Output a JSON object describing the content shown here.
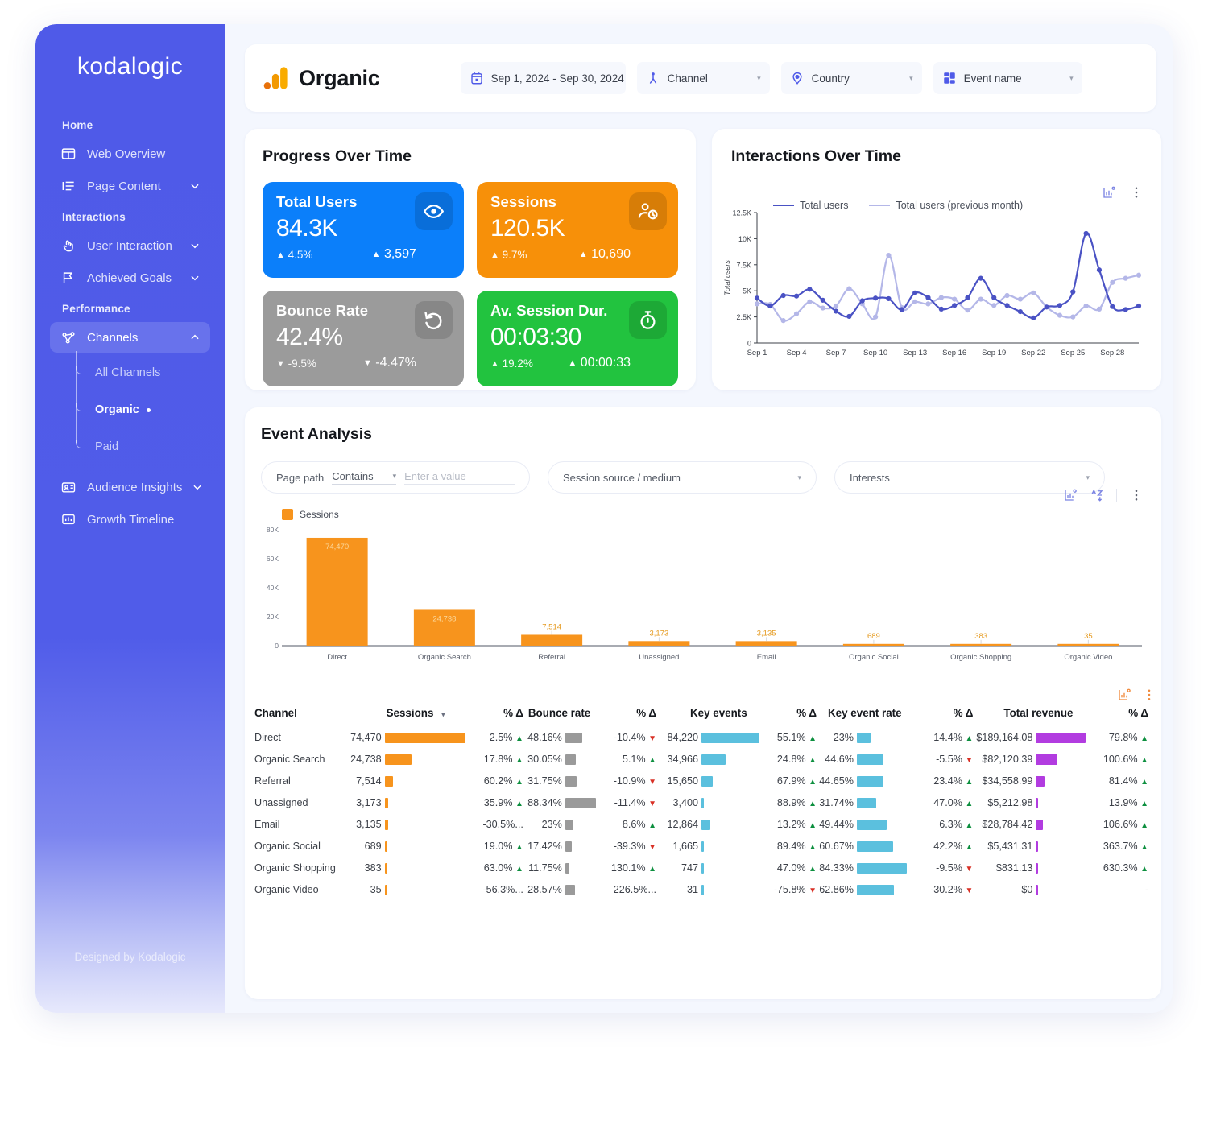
{
  "sidebar": {
    "brand": "kodalogic",
    "footer": "Designed by Kodalogic",
    "sections": [
      {
        "label": "Home",
        "items": [
          {
            "label": "Web Overview",
            "icon": "web-overview-icon",
            "chevron": false
          },
          {
            "label": "Page Content",
            "icon": "page-content-icon",
            "chevron": true
          }
        ]
      },
      {
        "label": "Interactions",
        "items": [
          {
            "label": "User Interaction",
            "icon": "hand-pointer-icon",
            "chevron": true
          },
          {
            "label": "Achieved Goals",
            "icon": "flag-icon",
            "chevron": true
          }
        ]
      },
      {
        "label": "Performance",
        "items": [
          {
            "label": "Channels",
            "icon": "share-nodes-icon",
            "chevron": true,
            "active": true
          }
        ]
      }
    ],
    "subitems": [
      {
        "label": "All Channels",
        "selected": false
      },
      {
        "label": "Organic",
        "selected": true
      },
      {
        "label": "Paid",
        "selected": false
      }
    ],
    "tail_items": [
      {
        "label": "Audience Insights",
        "icon": "audience-icon",
        "chevron": true
      },
      {
        "label": "Growth Timeline",
        "icon": "bar-chart-icon",
        "chevron": false
      }
    ]
  },
  "header": {
    "title": "Organic",
    "logo_icon": "google-analytics-icon",
    "filters": [
      {
        "label": "Sep 1, 2024 - Sep 30, 2024",
        "icon": "calendar-icon"
      },
      {
        "label": "Channel",
        "icon": "person-icon"
      },
      {
        "label": "Country",
        "icon": "location-pin-icon"
      },
      {
        "label": "Event name",
        "icon": "grid-blocks-icon"
      }
    ]
  },
  "progress": {
    "title": "Progress Over Time",
    "cards": [
      {
        "title": "Total Users",
        "value": "84.3K",
        "delta_pct": "4.5%",
        "delta_dir": "up",
        "delta_abs": "3,597",
        "abs_dir": "up",
        "color": "#0b7ffa",
        "icon": "eye-icon"
      },
      {
        "title": "Sessions",
        "value": "120.5K",
        "delta_pct": "9.7%",
        "delta_dir": "up",
        "delta_abs": "10,690",
        "abs_dir": "up",
        "color": "#f79009",
        "icon": "user-clock-icon"
      },
      {
        "title": "Bounce Rate",
        "value": "42.4%",
        "delta_pct": "-9.5%",
        "delta_dir": "down",
        "delta_abs": "-4.47%",
        "abs_dir": "down",
        "color": "#9b9b9b",
        "icon": "undo-icon"
      },
      {
        "title": "Av. Session Dur.",
        "value": "00:03:30",
        "delta_pct": "19.2%",
        "delta_dir": "up",
        "delta_abs": "00:00:33",
        "abs_dir": "up",
        "color": "#22c33f",
        "icon": "stopwatch-icon"
      }
    ]
  },
  "interactions": {
    "title": "Interactions Over Time",
    "tools": [
      {
        "icon": "insights-chart-icon"
      },
      {
        "icon": "more-vertical-icon"
      }
    ]
  },
  "event_analysis": {
    "title": "Event Analysis",
    "page_path_label": "Page path",
    "page_path_operator": "Contains",
    "page_path_placeholder": "Enter a value",
    "source_medium": "Session source / medium",
    "interests": "Interests",
    "tools": [
      {
        "icon": "insights-chart-icon"
      },
      {
        "icon": "sort-alpha-icon"
      },
      {
        "icon": "more-vertical-icon"
      }
    ],
    "table_tools": [
      {
        "icon": "insights-chart-icon"
      },
      {
        "icon": "more-vertical-icon"
      }
    ]
  },
  "chart_data": [
    {
      "type": "line",
      "title": "Interactions Over Time",
      "ylabel": "Total users",
      "xlabel": "",
      "ylim": [
        0,
        12500
      ],
      "yticks": [
        "0",
        "2.5K",
        "5K",
        "7.5K",
        "10K",
        "12.5K"
      ],
      "ytick_values": [
        0,
        2500,
        5000,
        7500,
        10000,
        12500
      ],
      "xticks": [
        "Sep 1",
        "Sep 4",
        "Sep 7",
        "Sep 10",
        "Sep 13",
        "Sep 16",
        "Sep 19",
        "Sep 22",
        "Sep 25",
        "Sep 28"
      ],
      "grid": false,
      "legend_position": "top-left",
      "colors": {
        "current": "#4a52c4",
        "previous": "#b4b7e8"
      },
      "x": [
        1,
        2,
        3,
        4,
        5,
        6,
        7,
        8,
        9,
        10,
        11,
        12,
        13,
        14,
        15,
        16,
        17,
        18,
        19,
        20,
        21,
        22,
        23,
        24,
        25,
        26,
        27,
        28,
        29,
        30
      ],
      "series": [
        {
          "name": "Total users",
          "values": [
            4300,
            3550,
            4550,
            4500,
            5150,
            4100,
            3050,
            2550,
            4050,
            4300,
            4250,
            3200,
            4800,
            4350,
            3250,
            3600,
            4350,
            6200,
            4350,
            3600,
            3000,
            2400,
            3450,
            3600,
            4900,
            10500,
            7000,
            3500,
            3200,
            3550
          ]
        },
        {
          "name": "Total users (previous month)",
          "values": [
            3750,
            3700,
            2150,
            2800,
            3950,
            3350,
            3550,
            5200,
            3750,
            2500,
            8400,
            3400,
            3950,
            3750,
            4350,
            4200,
            3150,
            4200,
            3600,
            4550,
            4200,
            4800,
            3450,
            2650,
            2500,
            3550,
            3250,
            5800,
            6200,
            6500
          ]
        }
      ]
    },
    {
      "type": "bar",
      "title": "",
      "legend": [
        "Sessions"
      ],
      "color": "#f7941d",
      "categories": [
        "Direct",
        "Organic Search",
        "Referral",
        "Unassigned",
        "Email",
        "Organic Social",
        "Organic Shopping",
        "Organic Video"
      ],
      "values": [
        74470,
        24738,
        7514,
        3173,
        3135,
        689,
        383,
        35
      ],
      "value_labels": [
        "74,470",
        "24,738",
        "7,514",
        "3,173",
        "3,135",
        "689",
        "383",
        "35"
      ],
      "ylim": [
        0,
        80000
      ],
      "yticks": [
        "0",
        "20K",
        "40K",
        "60K",
        "80K"
      ],
      "ylabel": "",
      "xlabel": "",
      "grid": false
    }
  ],
  "table": {
    "columns": [
      {
        "label": "Channel",
        "align": "left"
      },
      {
        "label": "Sessions",
        "align": "bar",
        "sorted": true
      },
      {
        "label": "% Δ",
        "align": "num"
      },
      {
        "label": "Bounce rate",
        "align": "bar"
      },
      {
        "label": "% Δ",
        "align": "num"
      },
      {
        "label": "Key events",
        "align": "bar"
      },
      {
        "label": "% Δ",
        "align": "num"
      },
      {
        "label": "Key event rate",
        "align": "bar"
      },
      {
        "label": "% Δ",
        "align": "num"
      },
      {
        "label": "Total revenue",
        "align": "bar"
      },
      {
        "label": "% Δ",
        "align": "num"
      }
    ],
    "bar_colors": {
      "sessions": "#f7941d",
      "bounce_rate": "#9a9a9a",
      "key_events": "#5bc0de",
      "key_event_rate": "#5bc0de",
      "total_revenue": "#b23ce0"
    },
    "rows": [
      {
        "channel": "Direct",
        "sessions": "74,470",
        "sessions_w": 100,
        "d1": "2.5%",
        "d1_dir": "up",
        "bounce": "48.16%",
        "bounce_w": 55,
        "d2": "-10.4%",
        "d2_dir": "down",
        "key_events": "84,220",
        "key_events_w": 100,
        "d3": "55.1%",
        "d3_dir": "up",
        "ker": "23%",
        "ker_w": 27,
        "d4": "14.4%",
        "d4_dir": "up",
        "revenue": "$189,164.08",
        "revenue_w": 100,
        "d5": "79.8%",
        "d5_dir": "up"
      },
      {
        "channel": "Organic Search",
        "sessions": "24,738",
        "sessions_w": 33,
        "d1": "17.8%",
        "d1_dir": "up",
        "bounce": "30.05%",
        "bounce_w": 34,
        "d2": "5.1%",
        "d2_dir": "up",
        "key_events": "34,966",
        "key_events_w": 41,
        "d3": "24.8%",
        "d3_dir": "up",
        "ker": "44.6%",
        "ker_w": 53,
        "d4": "-5.5%",
        "d4_dir": "down",
        "revenue": "$82,120.39",
        "revenue_w": 43,
        "d5": "100.6%",
        "d5_dir": "up"
      },
      {
        "channel": "Referral",
        "sessions": "7,514",
        "sessions_w": 10,
        "d1": "60.2%",
        "d1_dir": "up",
        "bounce": "31.75%",
        "bounce_w": 36,
        "d2": "-10.9%",
        "d2_dir": "down",
        "key_events": "15,650",
        "key_events_w": 19,
        "d3": "67.9%",
        "d3_dir": "up",
        "ker": "44.65%",
        "ker_w": 53,
        "d4": "23.4%",
        "d4_dir": "up",
        "revenue": "$34,558.99",
        "revenue_w": 18,
        "d5": "81.4%",
        "d5_dir": "up"
      },
      {
        "channel": "Unassigned",
        "sessions": "3,173",
        "sessions_w": 4,
        "d1": "35.9%",
        "d1_dir": "up",
        "bounce": "88.34%",
        "bounce_w": 100,
        "d2": "-11.4%",
        "d2_dir": "down",
        "key_events": "3,400",
        "key_events_w": 4,
        "d3": "88.9%",
        "d3_dir": "up",
        "ker": "31.74%",
        "ker_w": 38,
        "d4": "47.0%",
        "d4_dir": "up",
        "revenue": "$5,212.98",
        "revenue_w": 3,
        "d5": "13.9%",
        "d5_dir": "up"
      },
      {
        "channel": "Email",
        "sessions": "3,135",
        "sessions_w": 4,
        "d1": "-30.5%...",
        "d1_dir": "none",
        "bounce": "23%",
        "bounce_w": 26,
        "d2": "8.6%",
        "d2_dir": "up",
        "key_events": "12,864",
        "key_events_w": 15,
        "d3": "13.2%",
        "d3_dir": "up",
        "ker": "49.44%",
        "ker_w": 59,
        "d4": "6.3%",
        "d4_dir": "up",
        "revenue": "$28,784.42",
        "revenue_w": 15,
        "d5": "106.6%",
        "d5_dir": "up"
      },
      {
        "channel": "Organic Social",
        "sessions": "689",
        "sessions_w": 1,
        "d1": "19.0%",
        "d1_dir": "up",
        "bounce": "17.42%",
        "bounce_w": 20,
        "d2": "-39.3%",
        "d2_dir": "down",
        "key_events": "1,665",
        "key_events_w": 2,
        "d3": "89.4%",
        "d3_dir": "up",
        "ker": "60.67%",
        "ker_w": 72,
        "d4": "42.2%",
        "d4_dir": "up",
        "revenue": "$5,431.31",
        "revenue_w": 3,
        "d5": "363.7%",
        "d5_dir": "up"
      },
      {
        "channel": "Organic Shopping",
        "sessions": "383",
        "sessions_w": 1,
        "d1": "63.0%",
        "d1_dir": "up",
        "bounce": "11.75%",
        "bounce_w": 13,
        "d2": "130.1%",
        "d2_dir": "up",
        "key_events": "747",
        "key_events_w": 1,
        "d3": "47.0%",
        "d3_dir": "up",
        "ker": "84.33%",
        "ker_w": 100,
        "d4": "-9.5%",
        "d4_dir": "down",
        "revenue": "$831.13",
        "revenue_w": 1,
        "d5": "630.3%",
        "d5_dir": "up"
      },
      {
        "channel": "Organic Video",
        "sessions": "35",
        "sessions_w": 1,
        "d1": "-56.3%...",
        "d1_dir": "none",
        "bounce": "28.57%",
        "bounce_w": 32,
        "d2": "226.5%...",
        "d2_dir": "none",
        "key_events": "31",
        "key_events_w": 1,
        "d3": "-75.8%",
        "d3_dir": "down",
        "ker": "62.86%",
        "ker_w": 74,
        "d4": "-30.2%",
        "d4_dir": "down",
        "revenue": "$0",
        "revenue_w": 1,
        "d5": "-",
        "d5_dir": "none"
      }
    ]
  }
}
